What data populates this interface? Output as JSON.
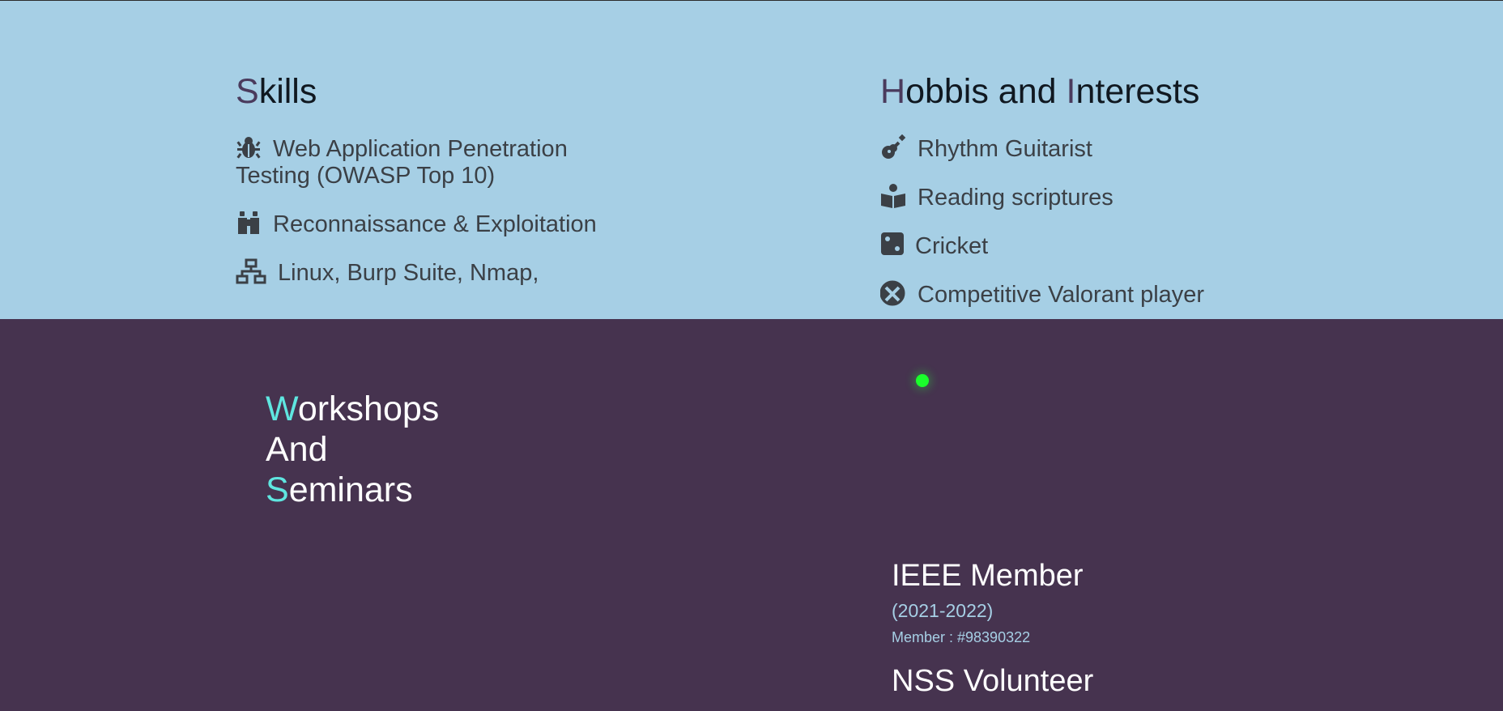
{
  "skills": {
    "heading_first": "S",
    "heading_rest": "kills",
    "items": [
      {
        "icon": "bug-icon",
        "label": "Web Application Penetration Testing (OWASP Top 10)"
      },
      {
        "icon": "binoculars-icon",
        "label": "Reconnaissance & Exploitation"
      },
      {
        "icon": "sitemap-icon",
        "label": "Linux, Burp Suite, Nmap,"
      }
    ]
  },
  "hobbies": {
    "heading_h": "H",
    "heading_mid": "obbis and ",
    "heading_i": "I",
    "heading_rest": "nterests",
    "items": [
      {
        "icon": "guitar-icon",
        "label": "Rhythm Guitarist"
      },
      {
        "icon": "book-reader-icon",
        "label": "Reading scriptures"
      },
      {
        "icon": "dice-icon",
        "label": "Cricket"
      },
      {
        "icon": "xbox-icon",
        "label": "Competitive Valorant player"
      }
    ]
  },
  "workshops": {
    "w": "W",
    "w_rest": "orkshops",
    "and": "And",
    "s": "S",
    "s_rest": "eminars"
  },
  "events": [
    {
      "title": "IEEE Member",
      "years": "(2021-2022)",
      "member": "Member : #98390322"
    },
    {
      "title": "NSS Volunteer"
    }
  ],
  "colors": {
    "top_bg": "#a6cfe5",
    "bottom_bg": "#46334f",
    "accent_top": "#4a3b5d",
    "accent_bottom": "#5fe6e0",
    "status_dot": "#1aff2b"
  }
}
